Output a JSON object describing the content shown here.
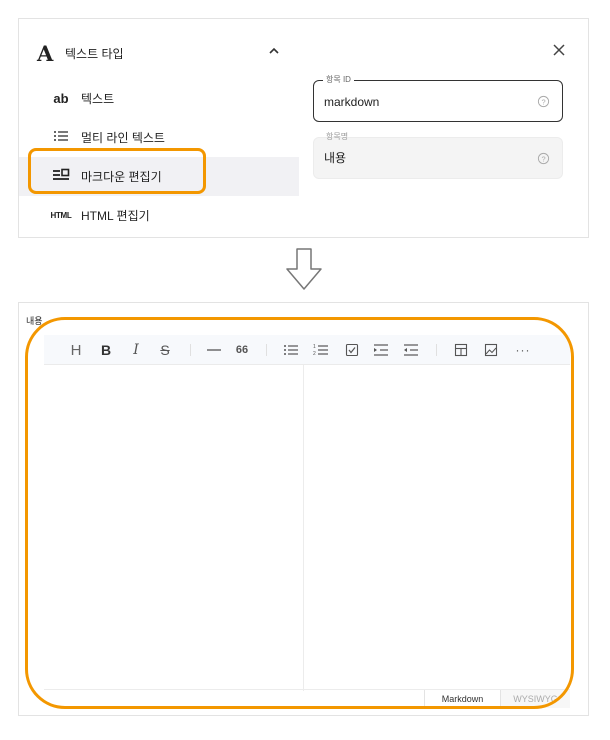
{
  "type_selector": {
    "title": "텍스트 타입",
    "items": [
      {
        "icon": "ab",
        "label": "텍스트",
        "icon_name": "ab-text-icon"
      },
      {
        "icon": "☰",
        "label": "멀티 라인 텍스트",
        "icon_name": "list-lines-icon"
      },
      {
        "icon": "≡",
        "label": "마크다운 편집기",
        "icon_name": "markdown-icon",
        "selected": true
      },
      {
        "icon": "HTML",
        "label": "HTML 편집기",
        "icon_name": "html-icon"
      }
    ]
  },
  "fields": {
    "id": {
      "label": "항목 ID",
      "value": "markdown"
    },
    "name": {
      "label": "항목명",
      "value": "내용"
    }
  },
  "editor": {
    "label": "내용",
    "modes": {
      "markdown": "Markdown",
      "wysiwyg": "WYSIWYG"
    }
  },
  "colors": {
    "highlight": "#f39700",
    "toolbar_bg": "#f7f9fc"
  }
}
